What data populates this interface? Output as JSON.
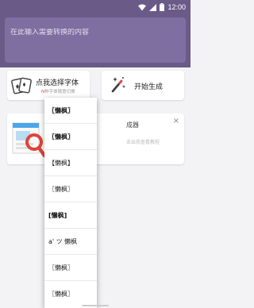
{
  "status_bar": {
    "time": "12:00",
    "icons": [
      "wifi-icon",
      "signal-icon",
      "battery-icon"
    ]
  },
  "input": {
    "placeholder": "在此输入需要转换的内容",
    "value": ""
  },
  "font_card": {
    "title": "点我选择字体",
    "subtitle_highlight": "N",
    "subtitle_rest": "种字体随意切换",
    "icon": "playing-cards-icon"
  },
  "generate_card": {
    "title": "开始生成",
    "icon": "magic-wand-icon"
  },
  "ad_card": {
    "title": "成器",
    "subtitle": "击出我查看教程",
    "close": "×"
  },
  "dropdown": {
    "items": [
      {
        "label": "〖懒枫〗"
      },
      {
        "label": "〖懒枫〗"
      },
      {
        "label": "【懒枫】"
      },
      {
        "label": "〖懒枫〗"
      },
      {
        "label": "[懒枫]"
      },
      {
        "label": "a' ツ 懒枫"
      },
      {
        "label": "〖懒枫〗"
      },
      {
        "label": "〖懒枫〗"
      }
    ]
  },
  "colors": {
    "header": "#6a5a88",
    "input_bg": "#7e6fa0",
    "accent_red": "#e0433b"
  }
}
